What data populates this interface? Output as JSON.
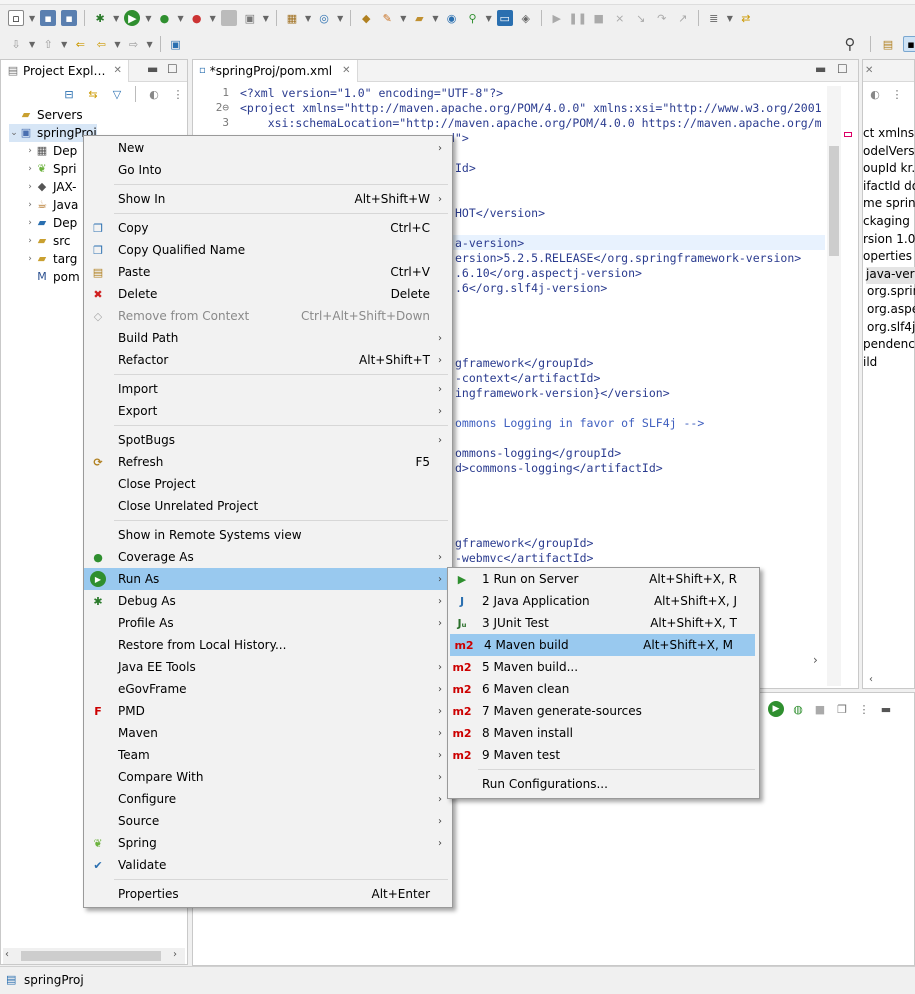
{
  "explorer": {
    "tab_title": "Project Expl…",
    "items": [
      {
        "label": "Servers",
        "indent": 0,
        "icon": "folder-icon"
      },
      {
        "label": "springProj",
        "indent": 0,
        "icon": "maven-project-icon"
      },
      {
        "label": "Dep",
        "indent": 1,
        "icon": "deployment-icon"
      },
      {
        "label": "Spri",
        "indent": 1,
        "icon": "spring-icon"
      },
      {
        "label": "JAX-",
        "indent": 1,
        "icon": "jax-icon"
      },
      {
        "label": "Java",
        "indent": 1,
        "icon": "java-resources-icon"
      },
      {
        "label": "Dep",
        "indent": 1,
        "icon": "deployed-resources-icon"
      },
      {
        "label": "src",
        "indent": 1,
        "icon": "folder-icon"
      },
      {
        "label": "targ",
        "indent": 1,
        "icon": "folder-icon"
      },
      {
        "label": "pom",
        "indent": 1,
        "icon": "pom-file-icon"
      }
    ]
  },
  "editor": {
    "tab_title": "*springProj/pom.xml",
    "lines": [
      {
        "n": "1",
        "text": "<?xml version=\"1.0\" encoding=\"UTF-8\"?>"
      },
      {
        "n": "2⊖",
        "text": "<project xmlns=\"http://maven.apache.org/POM/4.0.0\" xmlns:xsi=\"http://www.w3.org/2001"
      },
      {
        "n": "3",
        "text": "    xsi:schemaLocation=\"http://maven.apache.org/POM/4.0.0 https://maven.apache.org/m"
      }
    ],
    "fragments": [
      "Id>",
      "HOT</version>",
      "a-version>",
      "ersion>5.2.5.RELEASE</org.springframework-version>",
      ".6.10</org.aspectj-version>",
      ".6</org.slf4j-version>",
      "gframework</groupId>",
      "-context</artifactId>",
      "ingframework-version}</version>",
      "ommons Logging in favor of SLF4j -->",
      "ommons-logging</groupId>",
      "d>commons-logging</artifactId>",
      "gframework</groupId>",
      "-webmvc</artifactId>"
    ],
    "partial_line4": "d\">"
  },
  "outline": {
    "items": [
      "ct xmlns=",
      "odelVersio",
      "oupId kr.",
      "ifactId do",
      "me sprin",
      "ckaging",
      "rsion 1.0",
      "operties",
      "java-vers",
      "org.spring",
      "org.aspec",
      "org.slf4j-",
      "pendencie",
      "ild"
    ]
  },
  "context_menu": {
    "items": [
      {
        "label": "New",
        "arrow": true
      },
      {
        "label": "Go Into"
      },
      {
        "sep": true
      },
      {
        "label": "Show In",
        "shortcut": "Alt+Shift+W",
        "arrow": true
      },
      {
        "sep": true
      },
      {
        "label": "Copy",
        "shortcut": "Ctrl+C",
        "icon": "copy-icon"
      },
      {
        "label": "Copy Qualified Name",
        "icon": "copy-qualified-icon"
      },
      {
        "label": "Paste",
        "shortcut": "Ctrl+V",
        "icon": "paste-icon"
      },
      {
        "label": "Delete",
        "shortcut": "Delete",
        "icon": "delete-icon"
      },
      {
        "label": "Remove from Context",
        "shortcut": "Ctrl+Alt+Shift+Down",
        "icon": "remove-context-icon",
        "disabled": true
      },
      {
        "label": "Build Path",
        "arrow": true
      },
      {
        "label": "Refactor",
        "shortcut": "Alt+Shift+T",
        "arrow": true
      },
      {
        "sep": true
      },
      {
        "label": "Import",
        "arrow": true
      },
      {
        "label": "Export",
        "arrow": true
      },
      {
        "sep": true
      },
      {
        "label": "SpotBugs",
        "arrow": true
      },
      {
        "label": "Refresh",
        "shortcut": "F5",
        "icon": "refresh-icon"
      },
      {
        "label": "Close Project"
      },
      {
        "label": "Close Unrelated Project"
      },
      {
        "sep": true
      },
      {
        "label": "Show in Remote Systems view"
      },
      {
        "label": "Coverage As",
        "arrow": true,
        "icon": "coverage-icon"
      },
      {
        "label": "Run As",
        "arrow": true,
        "icon": "run-icon",
        "highlight": true
      },
      {
        "label": "Debug As",
        "arrow": true,
        "icon": "debug-icon"
      },
      {
        "label": "Profile As",
        "arrow": true
      },
      {
        "label": "Restore from Local History..."
      },
      {
        "label": "Java EE Tools",
        "arrow": true
      },
      {
        "label": "eGovFrame",
        "arrow": true
      },
      {
        "label": "PMD",
        "arrow": true,
        "icon": "pmd-icon"
      },
      {
        "label": "Maven",
        "arrow": true
      },
      {
        "label": "Team",
        "arrow": true
      },
      {
        "label": "Compare With",
        "arrow": true
      },
      {
        "label": "Configure",
        "arrow": true
      },
      {
        "label": "Source",
        "arrow": true
      },
      {
        "label": "Spring",
        "arrow": true,
        "icon": "spring-icon"
      },
      {
        "label": "Validate",
        "icon": "validate-checkbox-icon"
      },
      {
        "sep": true
      },
      {
        "label": "Properties",
        "shortcut": "Alt+Enter"
      }
    ]
  },
  "run_as_submenu": {
    "items": [
      {
        "label": "1 Run on Server",
        "shortcut": "Alt+Shift+X, R",
        "icon": "run-on-server-icon"
      },
      {
        "label": "2 Java Application",
        "shortcut": "Alt+Shift+X, J",
        "icon": "java-application-icon"
      },
      {
        "label": "3 JUnit Test",
        "shortcut": "Alt+Shift+X, T",
        "icon": "junit-icon"
      },
      {
        "label": "4 Maven build",
        "shortcut": "Alt+Shift+X, M",
        "icon": "m2-icon",
        "highlight": true
      },
      {
        "label": "5 Maven build...",
        "icon": "m2-icon"
      },
      {
        "label": "6 Maven clean",
        "icon": "m2-icon"
      },
      {
        "label": "7 Maven generate-sources",
        "icon": "m2-icon"
      },
      {
        "label": "8 Maven install",
        "icon": "m2-icon"
      },
      {
        "label": "9 Maven test",
        "icon": "m2-icon"
      },
      {
        "sep": true
      },
      {
        "label": "Run Configurations..."
      }
    ],
    "m2_label": "m2"
  },
  "statusbar": {
    "text": "springProj"
  },
  "colors": {
    "highlight": "#99c9ef",
    "accent": "#2f8f2f",
    "error": "#c00000"
  }
}
